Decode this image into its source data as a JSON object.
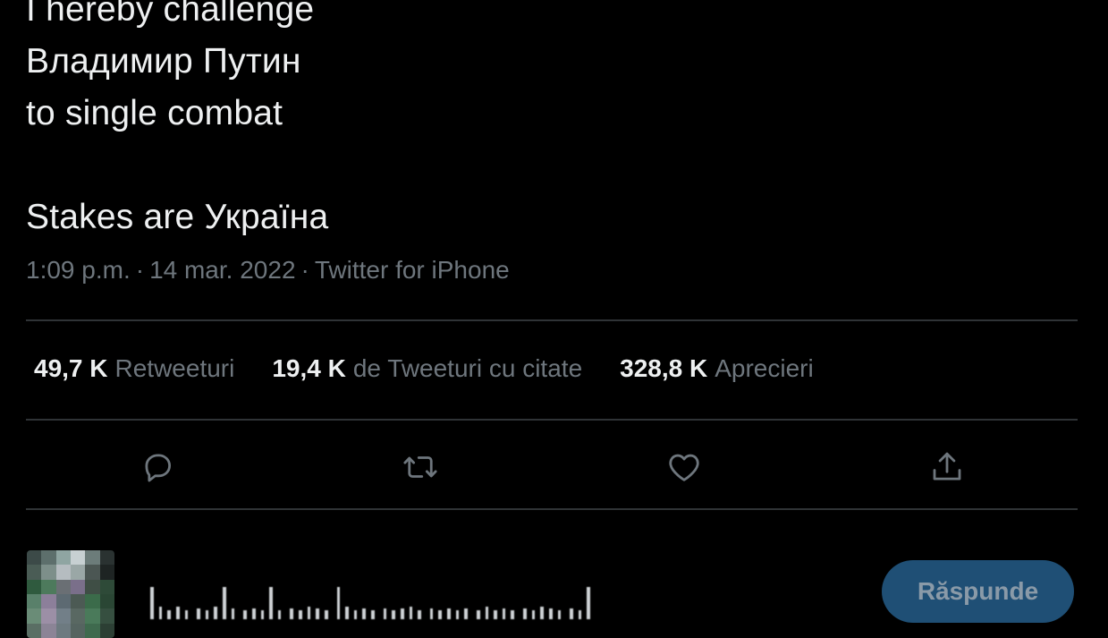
{
  "tweet": {
    "lines": [
      "I hereby challenge",
      "Владимир Путин",
      "to single combat",
      "",
      "Stakes are Україна"
    ],
    "time": "1:09 p.m.",
    "date": "14 mar. 2022",
    "source": "Twitter for iPhone",
    "separator": "·"
  },
  "stats": {
    "retweets_count": "49,7 K",
    "retweets_label": "Retweeturi",
    "quotes_count": "19,4 K",
    "quotes_label": "de Tweeturi cu citate",
    "likes_count": "328,8 K",
    "likes_label": "Aprecieri"
  },
  "actions": {
    "reply_icon": "comment-bubble-icon",
    "retweet_icon": "retweet-icon",
    "like_icon": "heart-icon",
    "share_icon": "share-upload-icon"
  },
  "reply_box": {
    "button_label": "Răspunde"
  },
  "colors": {
    "background": "#000000",
    "text": "#eef0f1",
    "muted": "#6e767d",
    "divider": "#2f3336",
    "button_bg": "#1f4f75"
  }
}
